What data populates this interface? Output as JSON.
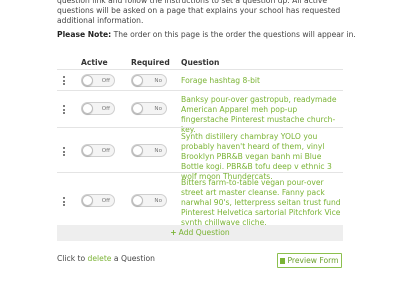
{
  "intro": {
    "text": "question link and follow the instructions to set a question up. All active questions will be asked on a page that explains your school has requested additional information."
  },
  "note": {
    "label": "Please Note:",
    "text": " The order on this page is the order the questions will appear in."
  },
  "headers": {
    "active": "Active",
    "required": "Required",
    "question": "Question"
  },
  "questions": [
    {
      "active": "Off",
      "required": "No",
      "text": "Forage hashtag 8-bit"
    },
    {
      "active": "Off",
      "required": "No",
      "text": "Banksy pour-over gastropub, readymade American Apparel meh pop-up fingerstache Pinterest mustache church-key."
    },
    {
      "active": "Off",
      "required": "No",
      "text": "Synth distillery chambray YOLO you probably haven't heard of them, vinyl Brooklyn PBR&B vegan banh mi Blue Bottle kogi. PBR&B tofu deep v ethnic 3 wolf moon Thundercats."
    },
    {
      "active": "Off",
      "required": "No",
      "text": "Bitters farm-to-table vegan pour-over street art master cleanse. Fanny pack narwhal 90's, letterpress seitan trust fund Pinterest Helvetica sartorial Pitchfork Vice synth chillwave cliche."
    }
  ],
  "add_question": {
    "plus": "+",
    "label": "Add Question"
  },
  "footer": {
    "prefix": "Click to ",
    "link": "delete",
    "suffix": " a Question"
  },
  "preview_button": {
    "label": "Preview Form",
    "icon": "document-icon"
  },
  "colors": {
    "accent_green": "#7ab334",
    "add_bar_bg": "#eeeeee",
    "toggle_bg": "#f4f4f4"
  }
}
